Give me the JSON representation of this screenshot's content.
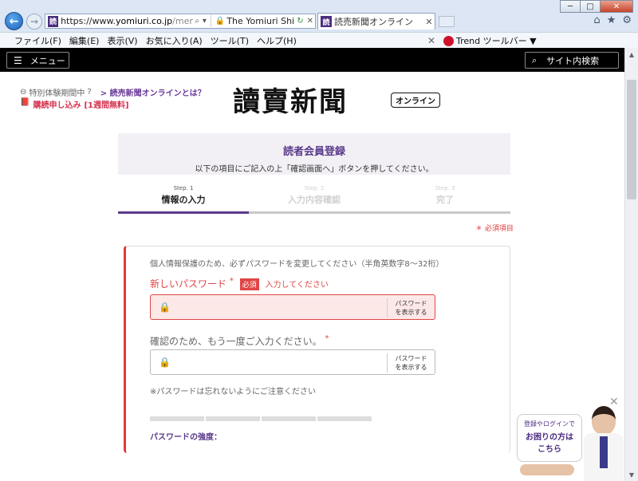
{
  "browser": {
    "url_prefix": "https://www.",
    "url_domain": "yomiuri.co.jp",
    "url_path": "/member/registrat",
    "addr_tab_title": "The Yomiuri Shim...",
    "active_tab_title": "読売新聞オンライン",
    "menu": [
      "ファイル(F)",
      "編集(E)",
      "表示(V)",
      "お気に入り(A)",
      "ツール(T)",
      "ヘルプ(H)"
    ],
    "toolbar_label": "Trend ツールバー ▼"
  },
  "header": {
    "menu_label": "メニュー",
    "search_label": "サイト内検索",
    "trial_text": "特別体験期間中",
    "about_link": "> 読売新聞オンラインとは？",
    "subscribe_text": "購読申し込み",
    "subscribe_badge": "[1週間無料]",
    "logo_text": "讀賣新聞",
    "logo_badge": "オンライン"
  },
  "form": {
    "title": "読者会員登録",
    "subtitle": "以下の項目にご記入の上「確認画面へ」ボタンを押してください。",
    "steps": [
      {
        "num": "Step. 1",
        "name": "情報の入力"
      },
      {
        "num": "Step. 2",
        "name": "入力内容確認"
      },
      {
        "num": "Step. 3",
        "name": "完了"
      }
    ],
    "required_note": "＊ 必須項目",
    "intro": "個人情報保護のため、必ずパスワードを変更してください（半角英数字8～32桁）",
    "new_password_label": "新しいパスワード",
    "required_badge": "必須",
    "error_text": "入力してください",
    "show_password": "パスワード\nを表示する",
    "confirm_label": "確認のため、もう一度ご入力ください。",
    "note": "※パスワードは忘れないようにご注意ください",
    "strength_label": "パスワードの強度："
  },
  "help_banner": {
    "line1": "登録やログインで",
    "line2": "お困りの方は",
    "line3": "こちら"
  }
}
